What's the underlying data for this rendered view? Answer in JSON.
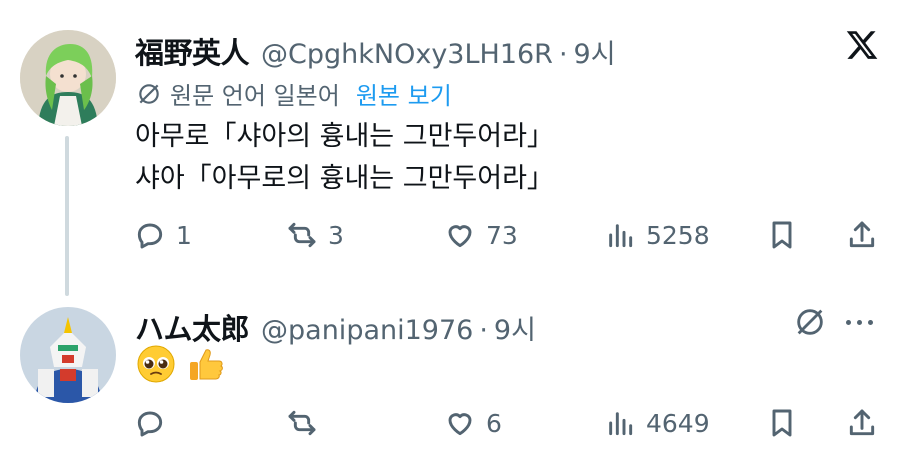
{
  "colors": {
    "accent": "#1d9bf0",
    "muted": "#536471",
    "text": "#0f1419",
    "thread_line": "#cfd9de"
  },
  "tweet1": {
    "author_name": "福野英人",
    "handle": "@CpghkNOxy3LH16R",
    "separator": "·",
    "time": "9시",
    "translation_note": "원문 언어 일본어",
    "view_original_label": "원본 보기",
    "text_line1": "아무로「샤아의 흉내는 그만두어라」",
    "text_line2": "샤아「아무로의 흉내는 그만두어라」",
    "replies": "1",
    "reposts": "3",
    "likes": "73",
    "views": "5258",
    "x_logo_icon": "x-logo-icon"
  },
  "tweet2": {
    "author_name": "ハム太郎",
    "handle": "@panipani1976",
    "separator": "·",
    "time": "9시",
    "emojis": [
      "pleading-face-emoji",
      "thumbs-up-emoji"
    ],
    "replies": "",
    "reposts": "",
    "likes": "6",
    "views": "4649"
  }
}
